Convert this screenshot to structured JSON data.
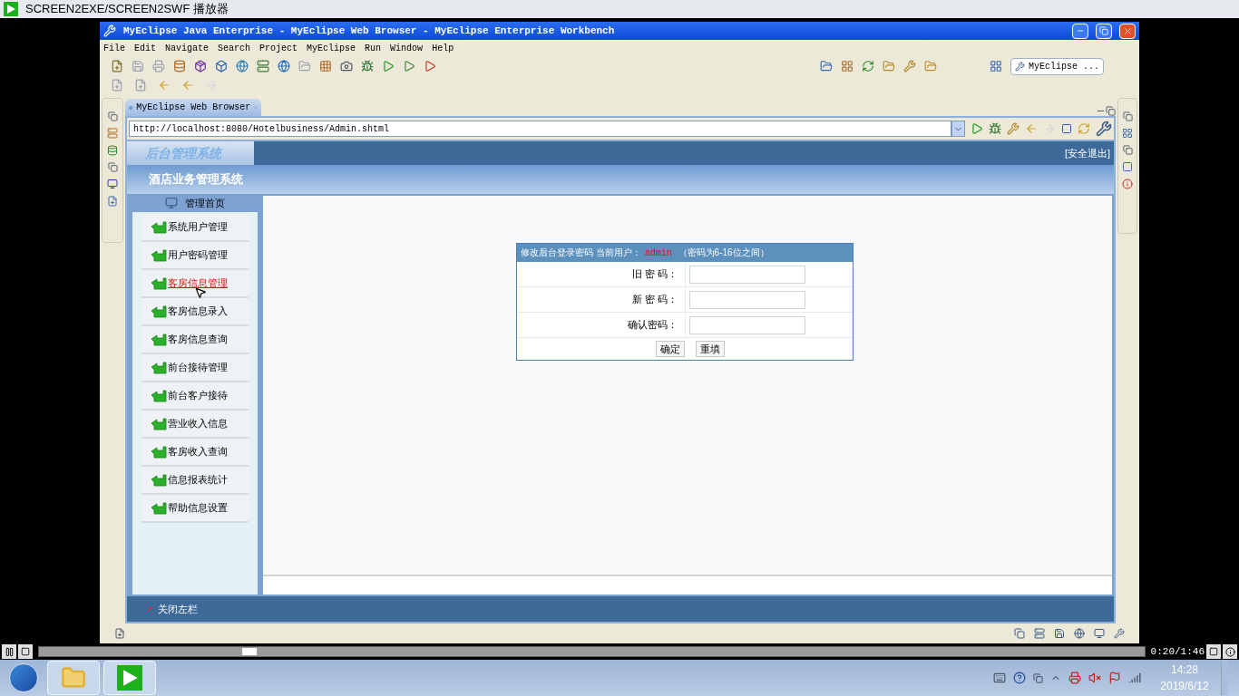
{
  "player": {
    "title": "SCREEN2EXE/SCREEN2SWF 播放器",
    "time": "0:20/1:46",
    "progress": {
      "level": 0.19
    }
  },
  "window": {
    "title": "MyEclipse Java Enterprise - MyEclipse Web Browser - MyEclipse Enterprise Workbench"
  },
  "menu": [
    "File",
    "Edit",
    "Navigate",
    "Search",
    "Project",
    "MyEclipse",
    "Run",
    "Window",
    "Help"
  ],
  "perspective": {
    "label": "MyEclipse ..."
  },
  "editor_tab": {
    "label": "MyEclipse Web Browser"
  },
  "address": {
    "value": "http://localhost:8080/Hotelbusiness/Admin.shtml"
  },
  "page": {
    "logo": "后台管理系统",
    "logout": "[安全退出]",
    "subtitle": "酒店业务管理系统",
    "home": "管理首页",
    "nav": [
      {
        "label": "系统用户管理",
        "selected": false
      },
      {
        "label": "用户密码管理",
        "selected": false
      },
      {
        "label": "客房信息管理",
        "selected": true
      },
      {
        "label": "客房信息录入",
        "selected": false
      },
      {
        "label": "客房信息查询",
        "selected": false
      },
      {
        "label": "前台接待管理",
        "selected": false
      },
      {
        "label": "前台客户接待",
        "selected": false
      },
      {
        "label": "营业收入信息",
        "selected": false
      },
      {
        "label": "客房收入查询",
        "selected": false
      },
      {
        "label": "信息报表统计",
        "selected": false
      },
      {
        "label": "帮助信息设置",
        "selected": false
      }
    ],
    "close_sidebar": "关闭左栏",
    "form": {
      "title": "修改后台登录密码 当前用户：",
      "user": "admin",
      "hint": "（密码为6-16位之间）",
      "fields": [
        {
          "label": "旧 密 码："
        },
        {
          "label": "新 密 码："
        },
        {
          "label": "确认密码："
        }
      ],
      "buttons": [
        "确定",
        "重填"
      ]
    }
  },
  "taskbar": {
    "apps": [
      {
        "kind": "folder"
      },
      {
        "kind": "player"
      }
    ],
    "time": "14:28",
    "date": "2019/6/12"
  }
}
